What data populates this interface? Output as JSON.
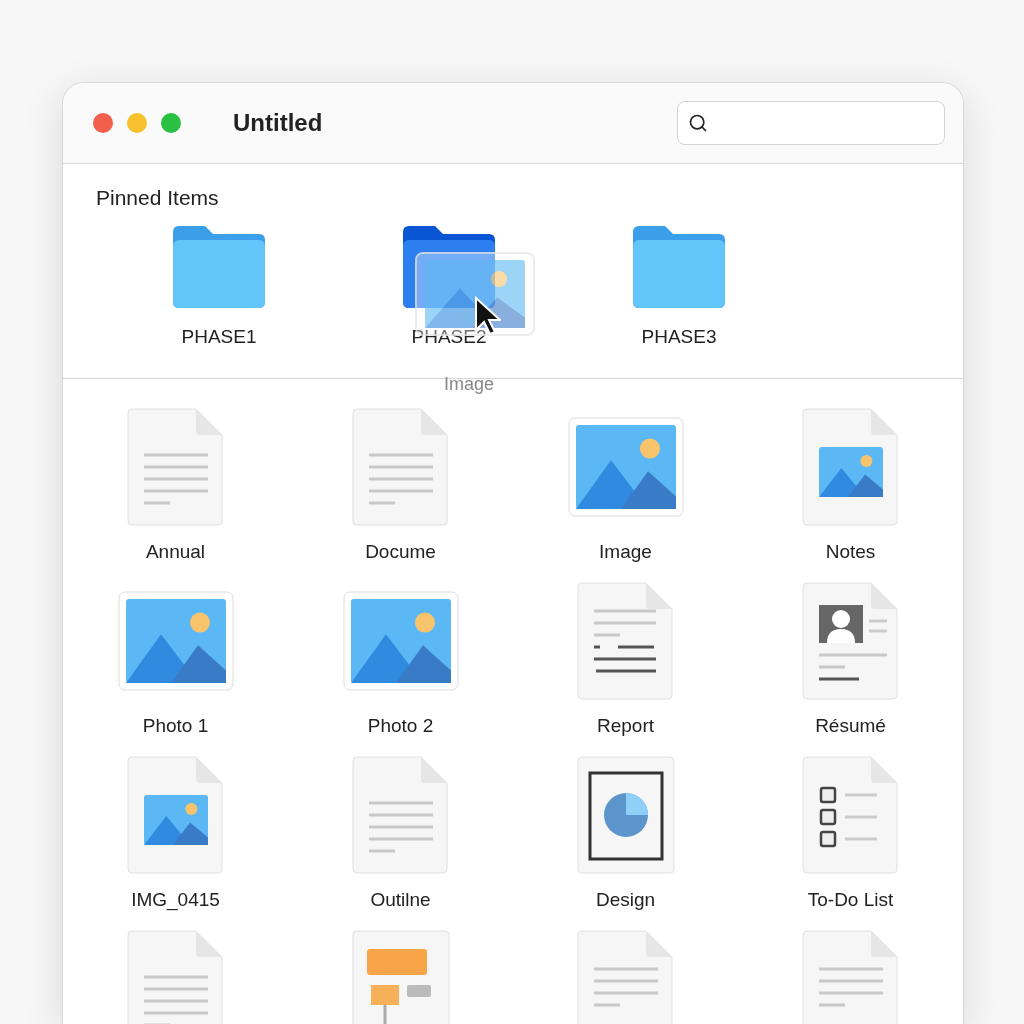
{
  "window": {
    "title": "Untitled"
  },
  "pinned": {
    "heading": "Pinned Items",
    "folders": [
      {
        "label": "PHASE1",
        "selected": false
      },
      {
        "label": "PHASE2",
        "selected": true
      },
      {
        "label": "PHASE3",
        "selected": false
      }
    ]
  },
  "drag": {
    "label": "Image"
  },
  "files": [
    {
      "label": "Annual",
      "kind": "document"
    },
    {
      "label": "Docume",
      "kind": "document"
    },
    {
      "label": "Image",
      "kind": "image"
    },
    {
      "label": "Notes",
      "kind": "image-document"
    },
    {
      "label": "Photo 1",
      "kind": "image"
    },
    {
      "label": "Photo 2",
      "kind": "image"
    },
    {
      "label": "Report",
      "kind": "report"
    },
    {
      "label": "Résumé",
      "kind": "resume"
    },
    {
      "label": "IMG_0415",
      "kind": "image-document"
    },
    {
      "label": "Outilne",
      "kind": "document"
    },
    {
      "label": "Design",
      "kind": "design"
    },
    {
      "label": "To-Do List",
      "kind": "todo"
    },
    {
      "kind": "document"
    },
    {
      "kind": "flowchart"
    },
    {
      "kind": "pdf"
    },
    {
      "kind": "pdf"
    }
  ]
}
